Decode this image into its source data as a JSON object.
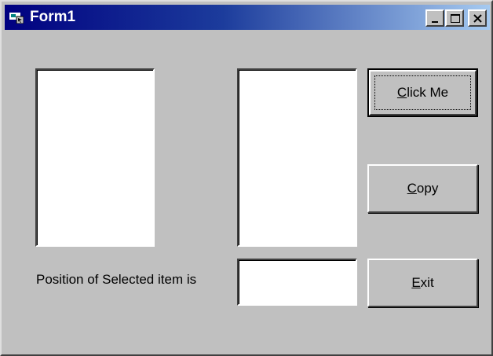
{
  "window": {
    "title": "Form1",
    "app_icon": "form-app-icon",
    "controls": {
      "minimize": "minimize-icon",
      "maximize": "maximize-icon",
      "close": "close-icon"
    }
  },
  "form": {
    "position_label": "Position of Selected item is",
    "position_value": "",
    "buttons": {
      "click_me": {
        "mnemonic": "C",
        "rest": "lick Me"
      },
      "copy": {
        "mnemonic": "C",
        "rest": "opy"
      },
      "exit": {
        "mnemonic": "E",
        "rest": "xit"
      }
    },
    "list1_items": [],
    "list2_items": []
  },
  "colors": {
    "face": "#c0c0c0",
    "titlebar_start": "#000080",
    "titlebar_end": "#a6caf0"
  }
}
